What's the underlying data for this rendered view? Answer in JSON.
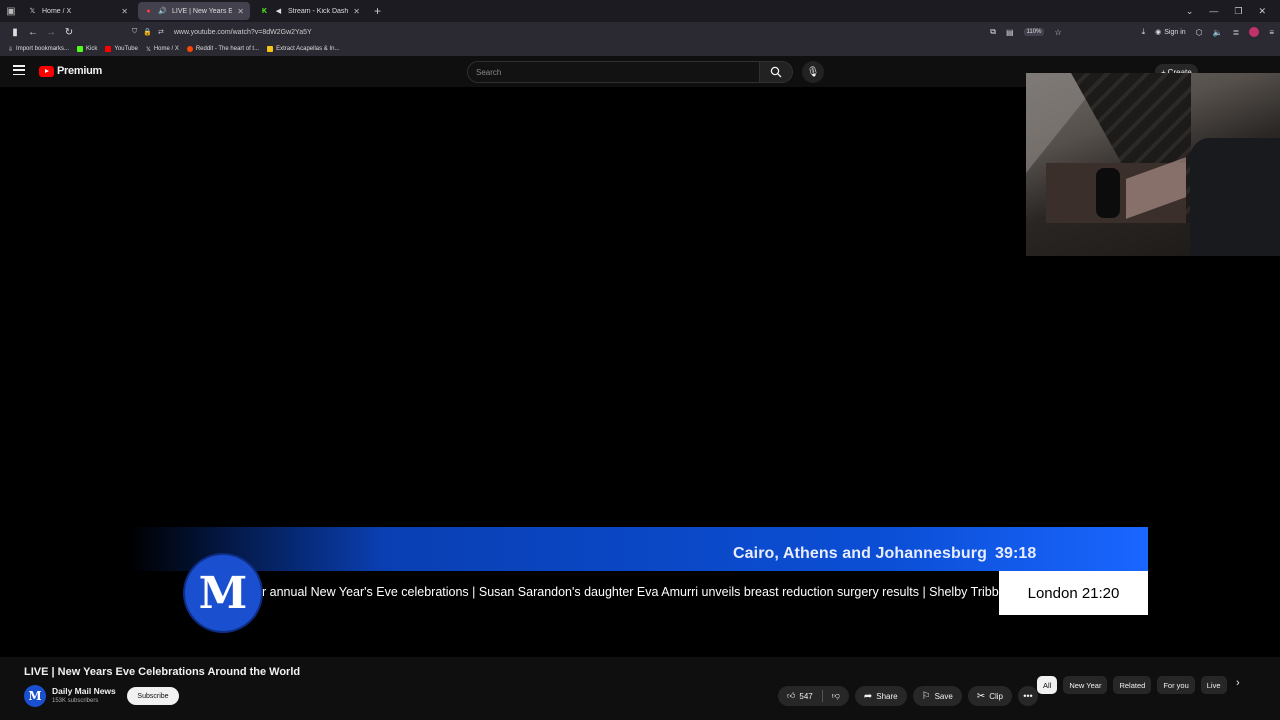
{
  "browser": {
    "tabs": [
      {
        "title": "Home / X",
        "favicon": "x-logo-icon",
        "active": false
      },
      {
        "title": "LIVE | New Years Eve Celeb",
        "favicon": "youtube-icon",
        "active": true
      },
      {
        "title": "Stream - Kick Dashboard",
        "favicon": "kick-icon",
        "active": false
      }
    ],
    "url": "www.youtube.com/watch?v=8dW2Gw2Ya5Y",
    "zoom": "110%",
    "sign_in": "Sign in",
    "bookmarks": [
      "Import bookmarks...",
      "Kick",
      "YouTube",
      "Home / X",
      "Reddit - The heart of t...",
      "Extract Acapellas & In..."
    ]
  },
  "youtube": {
    "logo_text": "Premium",
    "search_placeholder": "Search",
    "create_label": "Create"
  },
  "broadcast": {
    "city_line": "Cairo, Athens and Johannesburg",
    "city_time": "39:18",
    "ticker": "r annual New Year's Eve celebrations | Susan Sarandon's daughter Eva Amurri unveils breast reduction surgery results | Shelby Tribble",
    "london": "London 21:20",
    "logo_letter": "M"
  },
  "video": {
    "title": "LIVE | New Years Eve Celebrations Around the World",
    "channel": "Daily Mail News",
    "subscribers": "153K subscribers",
    "subscribe_label": "Subscribe",
    "likes": "547",
    "share_label": "Share",
    "save_label": "Save",
    "clip_label": "Clip"
  },
  "chips": [
    "All",
    "New Year",
    "Related",
    "For you",
    "Live"
  ],
  "colors": {
    "accent_blue": "#0b4fd6",
    "yt_red": "#ff0000"
  }
}
